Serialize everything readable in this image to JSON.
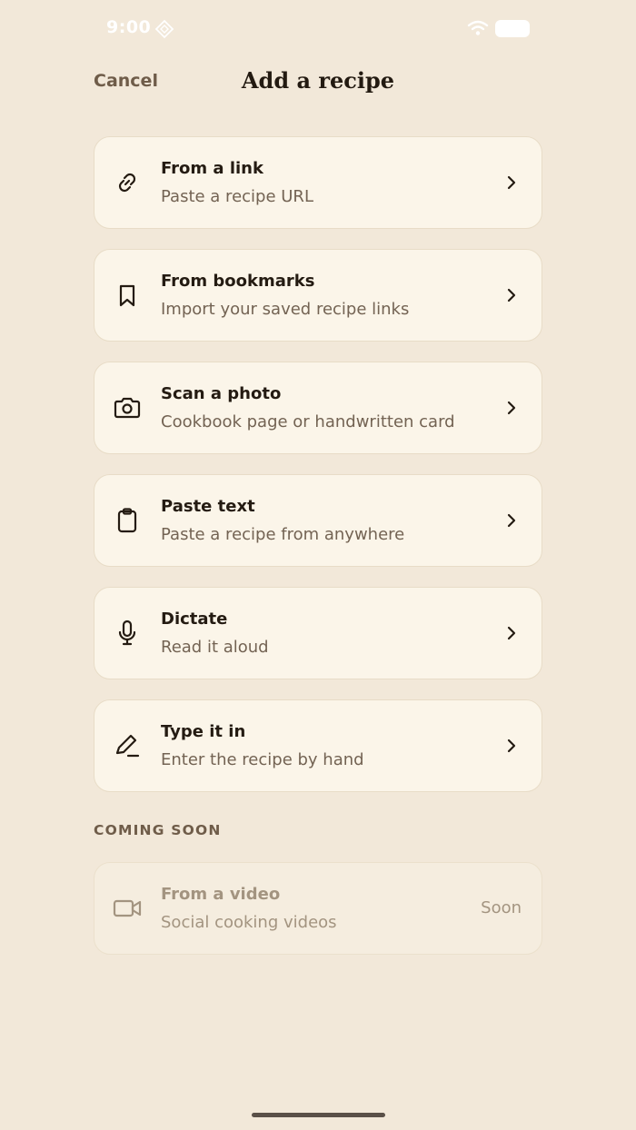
{
  "status_bar": {
    "time": "9:00"
  },
  "header": {
    "cancel_label": "Cancel",
    "title": "Add a recipe"
  },
  "options": [
    {
      "title": "From a link",
      "subtitle": "Paste a recipe URL",
      "icon": "link-icon"
    },
    {
      "title": "From bookmarks",
      "subtitle": "Import your saved recipe links",
      "icon": "bookmark-icon"
    },
    {
      "title": "Scan a photo",
      "subtitle": "Cookbook page or handwritten card",
      "icon": "camera-icon"
    },
    {
      "title": "Paste text",
      "subtitle": "Paste a recipe from anywhere",
      "icon": "clipboard-icon"
    },
    {
      "title": "Dictate",
      "subtitle": "Read it aloud",
      "icon": "microphone-icon"
    },
    {
      "title": "Type it in",
      "subtitle": "Enter the recipe by hand",
      "icon": "pencil-icon"
    }
  ],
  "coming_soon": {
    "section_label": "COMING SOON",
    "items": [
      {
        "title": "From a video",
        "subtitle": "Social cooking videos",
        "badge": "Soon",
        "icon": "video-icon"
      }
    ]
  },
  "colors": {
    "background": "#f2e8d9",
    "card": "#fbf5e9",
    "card_border": "#e8dcc7",
    "title_text": "#241b12",
    "subtitle_text": "#736353",
    "muted": "#a39480",
    "accent_label": "#6f5c49"
  }
}
